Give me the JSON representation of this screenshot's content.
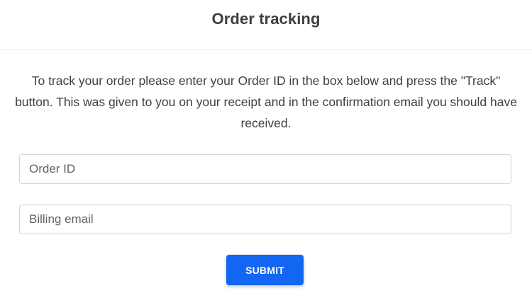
{
  "header": {
    "title": "Order tracking"
  },
  "intro": {
    "text": "To track your order please enter your Order ID in the box below and press the \"Track\" button. This was given to you on your receipt and in the confirmation email you should have received."
  },
  "form": {
    "order_id_placeholder": "Order ID",
    "order_id_value": "",
    "billing_email_placeholder": "Billing email",
    "billing_email_value": "",
    "submit_label": "SUBMIT"
  },
  "colors": {
    "accent": "#1266f1",
    "text": "#3c4043",
    "border": "#ced4da",
    "divider": "#e6e8eb"
  }
}
